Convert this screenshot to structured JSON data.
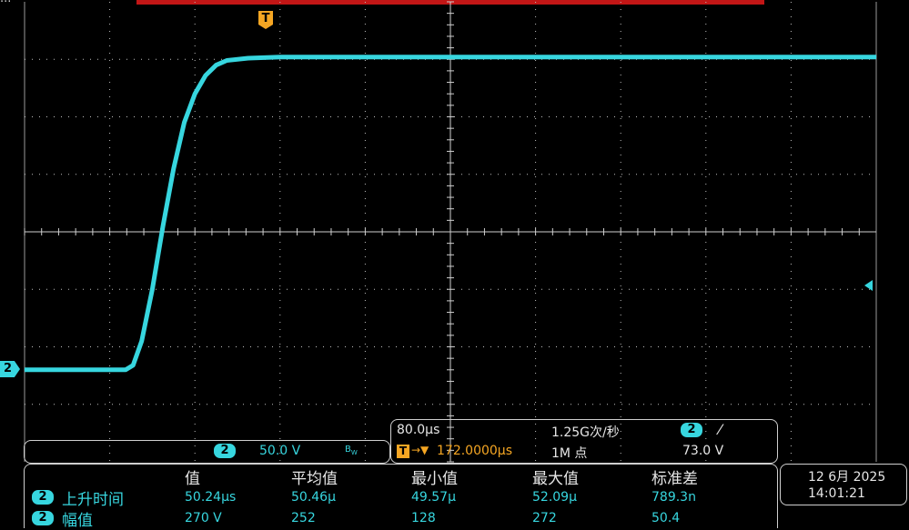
{
  "display": {
    "top_left_label": "...",
    "trigger_marker": "T",
    "channel_marker": "2",
    "grid": {
      "divisions_x": 10,
      "divisions_y": 8,
      "on": true
    },
    "colors": {
      "trace": "#37d6df",
      "grid": "#bfbfbf",
      "trigger": "#f5a623",
      "banner": "#c21616",
      "background": "#000000"
    }
  },
  "chart_data": {
    "type": "line",
    "title": "",
    "xlabel": "",
    "ylabel": "",
    "xlim": [
      0,
      800
    ],
    "ylim": [
      -200,
      200
    ],
    "series": [
      {
        "x": [
          0,
          95,
          102,
          110,
          120,
          130,
          140,
          150,
          160,
          170,
          180,
          190,
          210,
          240,
          300,
          800
        ],
        "values": [
          -120,
          -120,
          -116,
          -95,
          -50,
          5,
          55,
          95,
          120,
          136,
          145,
          149,
          151,
          152,
          152,
          152
        ]
      }
    ]
  },
  "channel_info": {
    "badge": "2",
    "scale": "50.0 V",
    "bw": "B",
    "bw_sub": "W"
  },
  "timebase": {
    "time_div": "80.0μs",
    "sample_rate": "1.25G次/秒",
    "trig_badge": "2",
    "trig_slope": "⁄",
    "trig_marker": "T",
    "position_arrow": "→▼",
    "position": "172.0000μs",
    "record_length": "1M 点",
    "trig_level": "73.0 V"
  },
  "measurements": {
    "headers": [
      "值",
      "平均值",
      "最小值",
      "最大值",
      "标准差"
    ],
    "rows": [
      {
        "badge": "2",
        "name": "上升时间",
        "values": [
          "50.24μs",
          "50.46μ",
          "49.57μ",
          "52.09μ",
          "789.3n"
        ]
      },
      {
        "badge": "2",
        "name": "幅值",
        "values": [
          "270 V",
          "252",
          "128",
          "272",
          "50.4"
        ]
      }
    ]
  },
  "datetime": {
    "date": "12 6月 2025",
    "time": "14:01:21"
  }
}
